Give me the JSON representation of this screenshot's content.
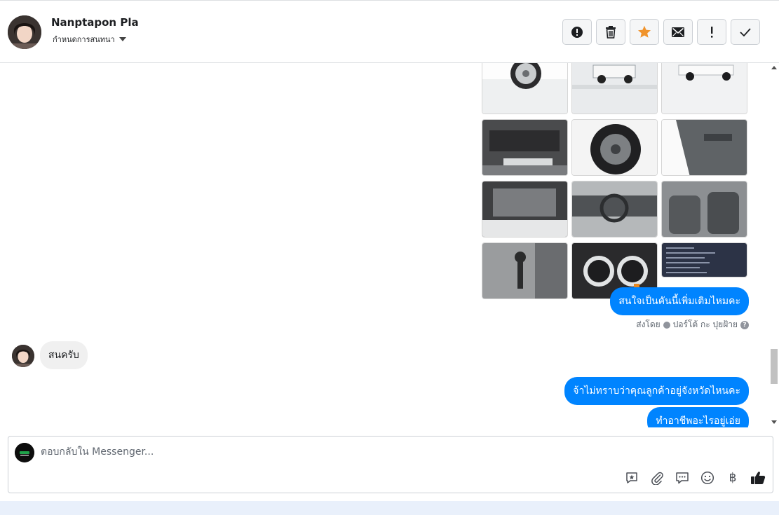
{
  "header": {
    "contact_name": "Nanptapon Pla",
    "conversation_label": "กำหนดการสนทนา",
    "actions": [
      {
        "name": "spam-button",
        "icon": "alert-circle-icon"
      },
      {
        "name": "delete-button",
        "icon": "trash-icon"
      },
      {
        "name": "star-button",
        "icon": "star-icon"
      },
      {
        "name": "mark-unread-button",
        "icon": "envelope-icon"
      },
      {
        "name": "important-button",
        "icon": "exclamation-icon"
      },
      {
        "name": "done-button",
        "icon": "check-icon"
      }
    ],
    "star_color": "#f0932b"
  },
  "thread": {
    "photos": [
      {
        "name": "photo-wheel-front",
        "tone": "#dfe3e6"
      },
      {
        "name": "photo-truck-rear-rack",
        "tone": "#e6e8ea"
      },
      {
        "name": "photo-truck-side",
        "tone": "#eceeef"
      },
      {
        "name": "photo-undercarriage",
        "tone": "#5d5e60"
      },
      {
        "name": "photo-spare-wheel",
        "tone": "#4b4c4f"
      },
      {
        "name": "photo-door-panel",
        "tone": "#8e9296"
      },
      {
        "name": "photo-engine-bay",
        "tone": "#6c6d70"
      },
      {
        "name": "photo-dashboard",
        "tone": "#7f8285"
      },
      {
        "name": "photo-front-seats",
        "tone": "#5c5f62"
      },
      {
        "name": "photo-gear-shifter",
        "tone": "#6f7174"
      },
      {
        "name": "photo-instrument-cluster",
        "tone": "#2a2a2c"
      },
      {
        "name": "photo-spec-sheet",
        "tone": "#2c3346"
      }
    ],
    "messages": [
      {
        "direction": "out",
        "text": "สนใจเป็นคันนี้เพิ่มเติมไหมคะ"
      },
      {
        "direction": "in",
        "text": "สนครับ"
      },
      {
        "direction": "out",
        "text": "จ้าไม่ทราบว่าคุณลูกค้าอยู่จังหวัดไหนคะ"
      },
      {
        "direction": "out",
        "text": "ทำอาชีพอะไรอยู่เอ่ย"
      }
    ],
    "sent_by": {
      "prefix": "ส่งโดย",
      "sender": "ปอร์โต้ กะ ปุยฝ้าย",
      "help": "?"
    },
    "bubble_color": "#0084ff"
  },
  "composer": {
    "placeholder": "ตอบกลับใน Messenger...",
    "tools": [
      "saved-reply-icon",
      "attachment-icon",
      "chat-bubble-icon",
      "emoji-icon",
      "baht-payment-icon",
      "thumbs-up-icon"
    ],
    "baht_symbol": "฿"
  }
}
